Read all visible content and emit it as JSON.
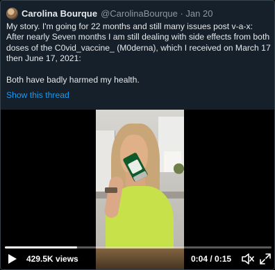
{
  "tweet": {
    "display_name": "Carolina Bourque",
    "handle_date": "@CarolinaBourque · Jan 20",
    "lines": [
      "My story. I'm going for 22 months and still many issues post v-a-x:",
      "After nearly Seven months I am still dealing with side effects from both",
      "doses of the C0vid_vaccine_ (M0derna), which I received on March 17",
      "then June 17, 2021:"
    ],
    "closing": "Both have badly harmed my health.",
    "show_thread": "Show this thread"
  },
  "video": {
    "progress": 0.27,
    "views": "429.5K views",
    "time": "0:04 / 0:15",
    "icons": {
      "play": "play-icon",
      "mute": "volume-muted-icon",
      "expand": "expand-icon"
    }
  },
  "colors": {
    "background": "#15202b",
    "text": "#e7e9ea",
    "muted": "#8b98a5",
    "link": "#1d9bf0",
    "shirt": "#c6e14a"
  }
}
